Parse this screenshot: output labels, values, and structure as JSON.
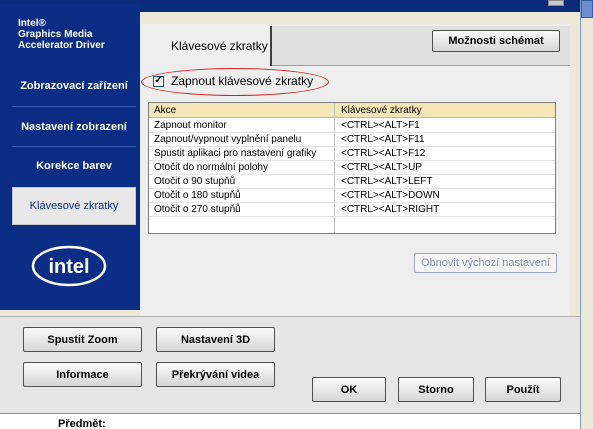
{
  "brand": {
    "title": "Intel®\nGraphics Media\nAccelerator Driver"
  },
  "sidebar": {
    "items": [
      {
        "label": "Zobrazovací zařízení"
      },
      {
        "label": "Nastavení zobrazení"
      },
      {
        "label": "Korekce barev"
      },
      {
        "label": "Klávesové zkratky"
      }
    ],
    "logo": "intel"
  },
  "tab": {
    "label": "Klávesové zkratky"
  },
  "scheme_button": {
    "label": "Možnosti schémat"
  },
  "enable_hotkeys": {
    "label": "Zapnout klávesové zkratky",
    "checked": true
  },
  "table": {
    "headers": [
      "Akce",
      "Klávesové zkratky"
    ],
    "rows": [
      {
        "action": "Zapnout monitor",
        "keys": "<CTRL><ALT>F1"
      },
      {
        "action": "Zapnout/vypnout vyplnění panelu",
        "keys": "<CTRL><ALT>F11"
      },
      {
        "action": "Spustit aplikaci pro nastavení grafiky",
        "keys": "<CTRL><ALT>F12"
      },
      {
        "action": "Otočit do normální polohy",
        "keys": "<CTRL><ALT>UP"
      },
      {
        "action": "Otočit o 90 stupňů",
        "keys": "<CTRL><ALT>LEFT"
      },
      {
        "action": "Otočit o 180 stupňů",
        "keys": "<CTRL><ALT>DOWN"
      },
      {
        "action": "Otočit o 270 stupňů",
        "keys": "<CTRL><ALT>RIGHT"
      }
    ]
  },
  "restore_button": {
    "label": "Obnovit výchozí nastavení"
  },
  "bottom": {
    "zoom": "Spustit Zoom",
    "settings3d": "Nastavení 3D",
    "info": "Informace",
    "overlay": "Překrývání videa",
    "ok": "OK",
    "cancel": "Storno",
    "apply": "Použít"
  },
  "background": {
    "subject_label": "Předmět:"
  },
  "colors": {
    "navy": "#0b2d86",
    "panel": "#eeeeee",
    "header": "#f5e6b8",
    "highlight": "#d42020"
  }
}
